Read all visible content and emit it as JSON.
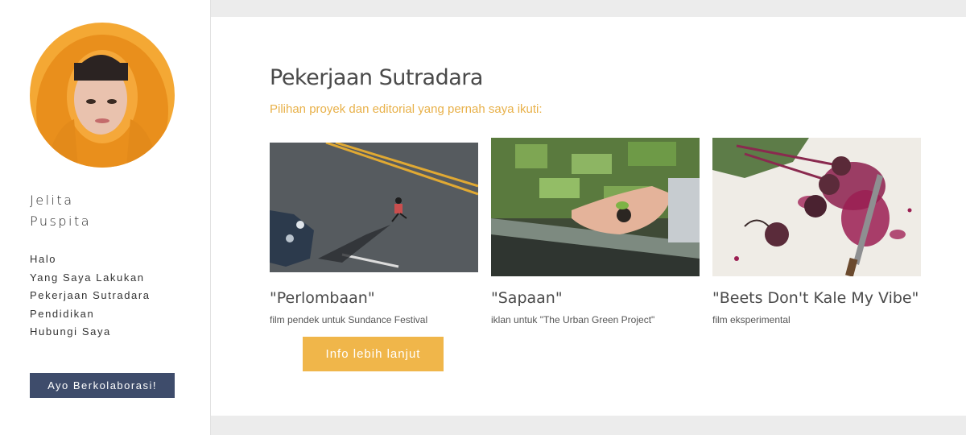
{
  "profile": {
    "first_name": "Jelita",
    "last_name": "Puspita"
  },
  "nav": {
    "items": [
      {
        "label": "Halo"
      },
      {
        "label": "Yang Saya Lakukan"
      },
      {
        "label": "Pekerjaan Sutradara"
      },
      {
        "label": "Pendidikan"
      },
      {
        "label": "Hubungi Saya"
      }
    ]
  },
  "sidebar": {
    "cta_label": "Ayo Berkolaborasi!"
  },
  "main": {
    "title": "Pekerjaan Sutradara",
    "subtitle": "Pilihan proyek dan editorial yang pernah saya ikuti:",
    "more_label": "Info lebih lanjut",
    "projects": [
      {
        "title": "\"Perlombaan\"",
        "desc": "film pendek untuk Sundance Festival"
      },
      {
        "title": "\"Sapaan\"",
        "desc": "iklan untuk \"The Urban Green Project\""
      },
      {
        "title": "\"Beets Don't Kale My Vibe\"",
        "desc": "film eksperimental"
      }
    ]
  },
  "colors": {
    "accent": "#f0b64a",
    "primary_button": "#3e4c6b",
    "subtitle": "#e8b14a"
  }
}
